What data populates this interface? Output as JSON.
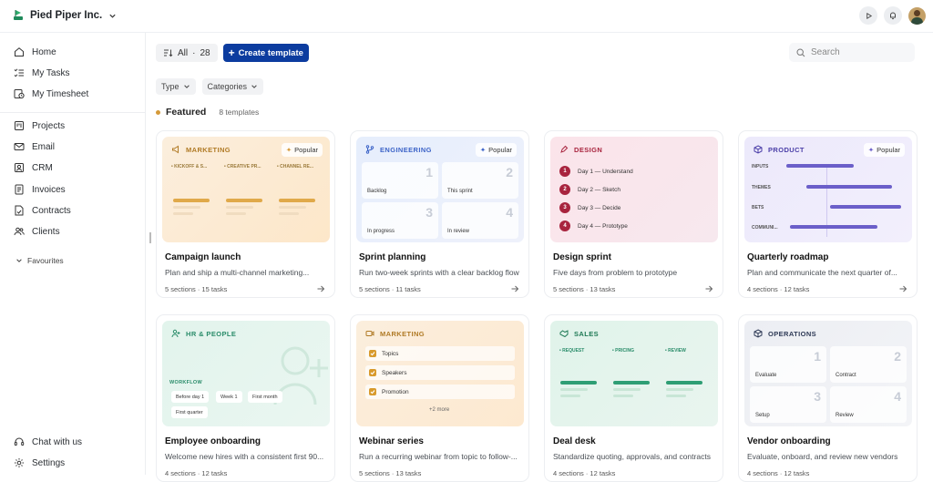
{
  "org": {
    "name": "Pied Piper Inc."
  },
  "sidebar": {
    "items": [
      {
        "label": "Home",
        "icon": "home-icon"
      },
      {
        "label": "My Tasks",
        "icon": "tasks-icon"
      },
      {
        "label": "My Timesheet",
        "icon": "timesheet-icon"
      },
      {
        "label": "Projects",
        "icon": "projects-icon"
      },
      {
        "label": "Email",
        "icon": "email-icon"
      },
      {
        "label": "CRM",
        "icon": "crm-icon"
      },
      {
        "label": "Invoices",
        "icon": "invoices-icon"
      },
      {
        "label": "Contracts",
        "icon": "contracts-icon"
      },
      {
        "label": "Clients",
        "icon": "clients-icon"
      }
    ],
    "favourites_label": "Favourites",
    "chat_label": "Chat with us",
    "settings_label": "Settings"
  },
  "toolbar": {
    "all_label": "All",
    "all_count": "28",
    "create_label": "Create template"
  },
  "search": {
    "placeholder": "Search"
  },
  "filters": {
    "type_label": "Type",
    "categories_label": "Categories"
  },
  "featured": {
    "title": "Featured",
    "count": "8 templates"
  },
  "popular_label": "Popular",
  "cards": [
    {
      "category": "MARKETING",
      "title": "Campaign launch",
      "desc": "Plan and ship a multi-channel marketing...",
      "meta": "5 sections · 15 tasks",
      "popular": true,
      "cols": [
        "KICKOFF & S...",
        "CREATIVE PR...",
        "CHANNEL RE..."
      ]
    },
    {
      "category": "ENGINEERING",
      "title": "Sprint planning",
      "desc": "Run two-week sprints with a clear backlog flow",
      "meta": "5 sections · 11 tasks",
      "popular": true,
      "cells": [
        "Backlog",
        "This sprint",
        "In progress",
        "In review"
      ]
    },
    {
      "category": "DESIGN",
      "title": "Design sprint",
      "desc": "Five days from problem to prototype",
      "meta": "5 sections · 13 tasks",
      "popular": false,
      "steps": [
        "Day 1 — Understand",
        "Day 2 — Sketch",
        "Day 3 — Decide",
        "Day 4 — Prototype"
      ]
    },
    {
      "category": "PRODUCT",
      "title": "Quarterly roadmap",
      "desc": "Plan and communicate the next quarter of...",
      "meta": "4 sections · 12 tasks",
      "popular": true,
      "rows": [
        "INPUTS",
        "THEMES",
        "BETS",
        "COMMUNI..."
      ]
    },
    {
      "category": "HR & PEOPLE",
      "title": "Employee onboarding",
      "desc": "Welcome new hires with a consistent first 90...",
      "meta": "4 sections · 12 tasks",
      "popular": false,
      "workflow_label": "WORKFLOW",
      "chips": [
        "Before day 1",
        "Week 1",
        "First month",
        "First quarter"
      ]
    },
    {
      "category": "MARKETING",
      "title": "Webinar series",
      "desc": "Run a recurring webinar from topic to follow-...",
      "meta": "5 sections · 13 tasks",
      "popular": false,
      "checks": [
        "Topics",
        "Speakers",
        "Promotion"
      ],
      "more": "+2 more"
    },
    {
      "category": "SALES",
      "title": "Deal desk",
      "desc": "Standardize quoting, approvals, and contracts",
      "meta": "4 sections · 12 tasks",
      "popular": false,
      "cols": [
        "REQUEST",
        "PRICING",
        "REVIEW"
      ]
    },
    {
      "category": "OPERATIONS",
      "title": "Vendor onboarding",
      "desc": "Evaluate, onboard, and review new vendors",
      "meta": "4 sections · 12 tasks",
      "popular": false,
      "cells": [
        "Evaluate",
        "Contract",
        "Setup",
        "Review"
      ]
    }
  ],
  "colors": {
    "primary": "#0c3c9f",
    "marketing": "#d59a3a",
    "engineering": "#3d64c8",
    "design": "#a8243e",
    "product": "#6b5fc9",
    "hr": "#2a8c6a",
    "sales": "#2e9e74",
    "operations": "#3d4a6b"
  }
}
